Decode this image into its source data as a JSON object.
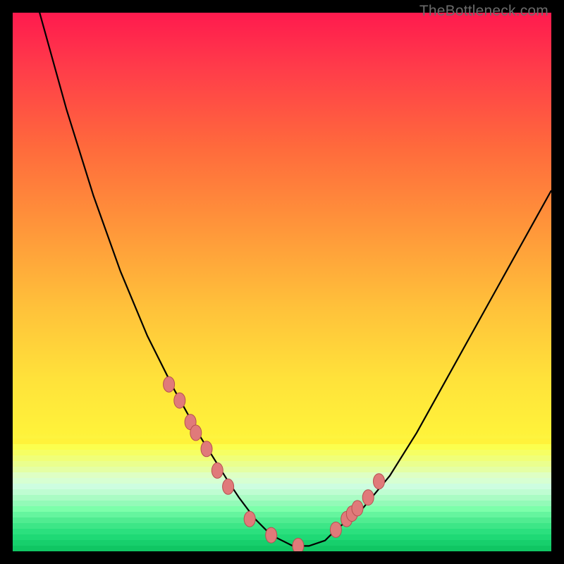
{
  "watermark": {
    "text": "TheBottleneck.com"
  },
  "colors": {
    "frame": "#000000",
    "curve": "#000000",
    "marker_fill": "#e07a7a",
    "marker_stroke": "#b65050",
    "gradient_top": "#ff1a4e",
    "gradient_bottom": "#2be07e"
  },
  "chart_data": {
    "type": "line",
    "title": "",
    "xlabel": "",
    "ylabel": "",
    "xlim": [
      0,
      100
    ],
    "ylim": [
      0,
      100
    ],
    "series": [
      {
        "name": "bottleneck-curve",
        "x": [
          0,
          5,
          10,
          15,
          20,
          25,
          30,
          35,
          40,
          42,
          45,
          48,
          50,
          52,
          55,
          58,
          60,
          65,
          70,
          75,
          80,
          85,
          90,
          95,
          100
        ],
        "values": [
          120,
          100,
          82,
          66,
          52,
          40,
          30,
          21,
          13,
          10,
          6,
          3,
          2,
          1,
          1,
          2,
          4,
          8,
          14,
          22,
          31,
          40,
          49,
          58,
          67
        ]
      }
    ],
    "markers": {
      "name": "highlighted-points",
      "x": [
        29,
        31,
        33,
        34,
        36,
        38,
        40,
        44,
        48,
        53,
        60,
        62,
        63,
        64,
        66,
        68
      ],
      "values": [
        31,
        28,
        24,
        22,
        19,
        15,
        12,
        6,
        3,
        1,
        4,
        6,
        7,
        8,
        10,
        13
      ]
    }
  }
}
